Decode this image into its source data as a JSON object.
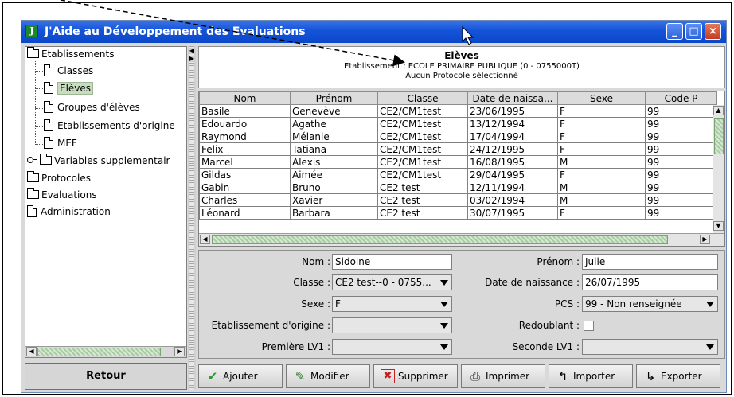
{
  "window": {
    "title": "J'Aide au Développement des Evaluations",
    "app_icon": "j-app-icon",
    "controls": [
      "minimize-icon",
      "maximize-icon",
      "close-icon"
    ]
  },
  "tree": {
    "items": [
      {
        "label": "Etablissements",
        "icon": "folder-icon",
        "level": 0
      },
      {
        "label": "Classes",
        "icon": "document-icon",
        "level": 1
      },
      {
        "label": "Elèves",
        "icon": "document-icon",
        "level": 1,
        "selected": true
      },
      {
        "label": "Groupes d'élèves",
        "icon": "document-icon",
        "level": 1
      },
      {
        "label": "Etablissements d'origine",
        "icon": "document-icon",
        "level": 1
      },
      {
        "label": "MEF",
        "icon": "document-icon",
        "level": 1
      },
      {
        "label": "Variables supplementair",
        "icon": "folder-icon",
        "level": 0
      },
      {
        "label": "Protocoles",
        "icon": "folder-icon",
        "level": 0
      },
      {
        "label": "Evaluations",
        "icon": "folder-icon",
        "level": 0
      },
      {
        "label": "Administration",
        "icon": "document-icon",
        "level": 0
      }
    ],
    "retour_label": "Retour"
  },
  "header": {
    "title": "Elèves",
    "etablissement_line": "Etablissement : ECOLE PRIMAIRE PUBLIQUE (0 - 0755000T)",
    "protocole_line": "Aucun Protocole sélectionné"
  },
  "table": {
    "columns": [
      "Nom",
      "Prénom",
      "Classe",
      "Date de naissa...",
      "Sexe",
      "Code P"
    ],
    "rows": [
      [
        "Basile",
        "Genevève",
        "CE2/CM1test",
        "23/06/1995",
        "F",
        "99"
      ],
      [
        "Edouardo",
        "Agathe",
        "CE2/CM1test",
        "13/12/1994",
        "F",
        "99"
      ],
      [
        "Raymond",
        "Mélanie",
        "CE2/CM1test",
        "17/04/1994",
        "F",
        "99"
      ],
      [
        "Felix",
        "Tatiana",
        "CE2/CM1test",
        "24/12/1995",
        "F",
        "99"
      ],
      [
        "Marcel",
        "Alexis",
        "CE2/CM1test",
        "16/08/1995",
        "M",
        "99"
      ],
      [
        "Gildas",
        "Aimée",
        "CE2/CM1test",
        "29/04/1995",
        "F",
        "99"
      ],
      [
        "Gabin",
        "Bruno",
        "CE2 test",
        "12/11/1994",
        "M",
        "99"
      ],
      [
        "Charles",
        "Xavier",
        "CE2 test",
        "03/02/1994",
        "M",
        "99"
      ],
      [
        "Léonard",
        "Barbara",
        "CE2 test",
        "30/07/1995",
        "F",
        "99"
      ]
    ]
  },
  "form": {
    "nom_label": "Nom :",
    "nom_value": "Sidoine",
    "prenom_label": "Prénom :",
    "prenom_value": "Julie",
    "classe_label": "Classe :",
    "classe_value": "CE2 test--0 - 0755...",
    "naissance_label": "Date de naissance :",
    "naissance_value": "26/07/1995",
    "sexe_label": "Sexe :",
    "sexe_value": "F",
    "pcs_label": "PCS :",
    "pcs_value": "99 - Non renseignée",
    "etab_origine_label": "Etablissement d'origine :",
    "etab_origine_value": "",
    "redoublant_label": "Redoublant :",
    "lv1_label": "Première LV1 :",
    "lv1_value": "",
    "lv2_label": "Seconde LV1 :",
    "lv2_value": ""
  },
  "actions": [
    {
      "label": "Ajouter",
      "icon": "checkmark-icon",
      "color": "#2e9a2e"
    },
    {
      "label": "Modifier",
      "icon": "edit-icon",
      "color": "#2e7a2e"
    },
    {
      "label": "Supprimer",
      "icon": "delete-icon",
      "color": "#c82020"
    },
    {
      "label": "Imprimer",
      "icon": "printer-icon",
      "color": "#333333"
    },
    {
      "label": "Importer",
      "icon": "import-icon",
      "color": "#000000"
    },
    {
      "label": "Exporter",
      "icon": "export-icon",
      "color": "#000000"
    }
  ],
  "colors": {
    "titlebar": "#1453d8",
    "selection": "#c9dcc0",
    "scroll_thumb": "#a7cba2"
  }
}
